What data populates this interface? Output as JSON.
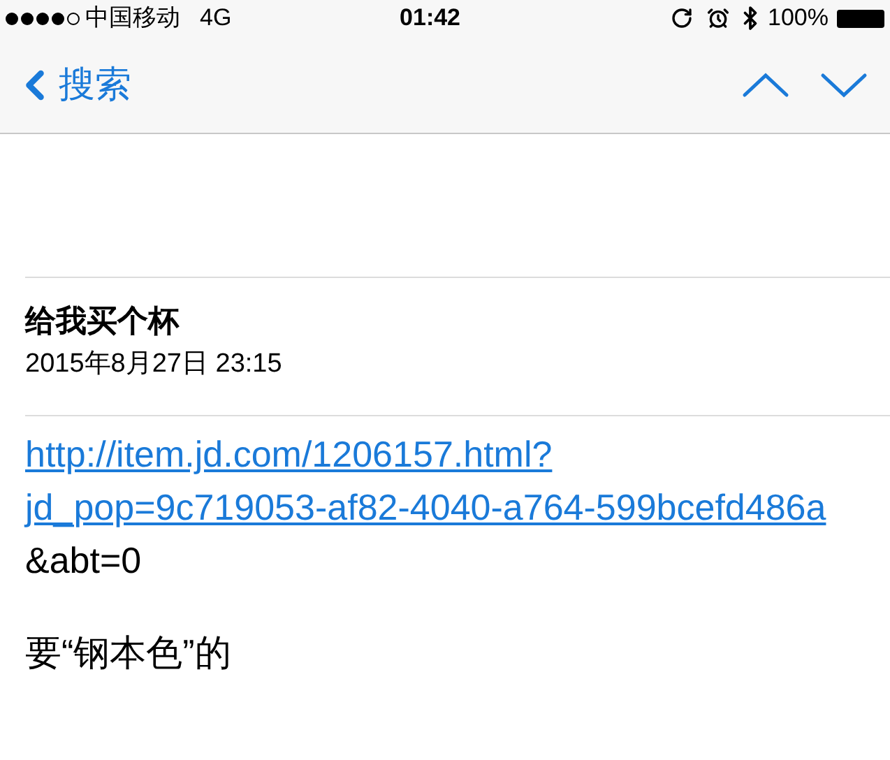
{
  "status_bar": {
    "carrier": "中国移动",
    "network": "4G",
    "time": "01:42",
    "battery": "100%"
  },
  "nav": {
    "back_label": "搜索"
  },
  "message": {
    "subject": "给我买个杯",
    "date": "2015年8月27日 23:15",
    "link_lines": [
      "http://item.jd.com/1206157.html?",
      "jd_pop=9c719053-af82-4040-a764-599bcefd486a"
    ],
    "link_tail": "&abt=0",
    "note": "要“钢本色”的"
  }
}
